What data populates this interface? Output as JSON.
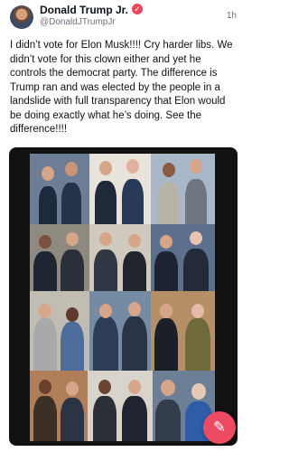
{
  "post": {
    "author_name": "Donald Trump Jr.",
    "author_handle": "@DonaldJTrumpJr",
    "time_ago": "1h",
    "text": "I didn’t vote for Elon Musk!!!! Cry harder libs. We didn’t vote for this clown either and yet he controls the democrat party. The difference is Trump ran and was elected by the people in a landslide with full transparency that Elon would be doing exactly what he’s doing. See the difference!!!!"
  },
  "icons": {
    "verified": "verified-badge-icon",
    "compose": "compose-pencil-icon"
  },
  "colors": {
    "badge": "#f0455d",
    "compose_button": "#ef4a63",
    "media_background": "#111111"
  }
}
